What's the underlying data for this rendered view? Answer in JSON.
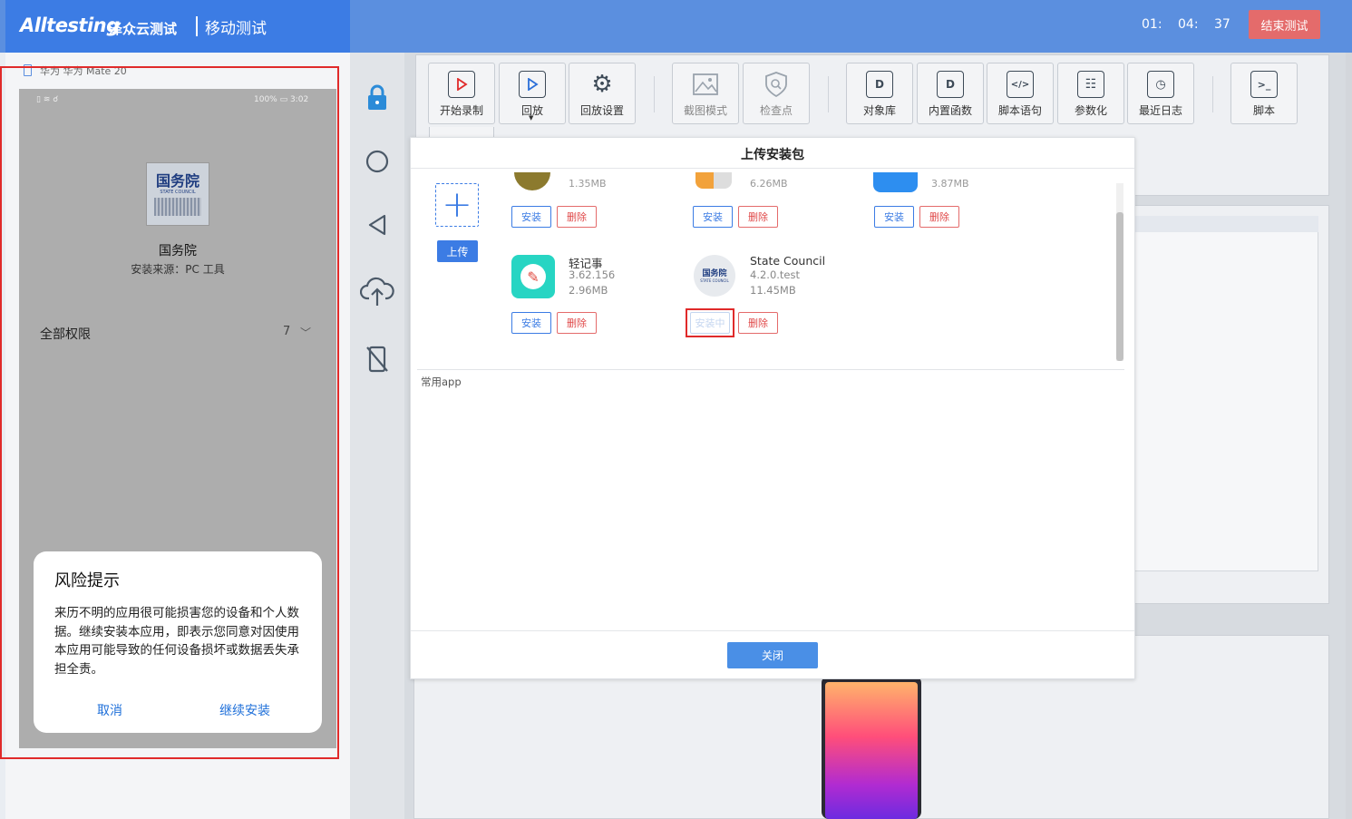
{
  "header": {
    "logo_text": "Alltesting",
    "logo_cn": "泽众云测试",
    "module_title": "移动测试",
    "timer": {
      "hours": "01:",
      "minutes": "04:",
      "seconds": "37"
    },
    "end_button": "结束测试",
    "brand_color": "#3c7ce4",
    "end_button_color": "#e46b6b"
  },
  "device": {
    "name": "华为 华为 Mate 20",
    "status_left": "▯ ≋ ☌",
    "status_right": "100% ▭ 3:02",
    "app_icon_cn": "国务院",
    "app_icon_en": "STATE COUNCIL",
    "app_name": "国务院",
    "install_source": "安装来源：PC 工具",
    "permissions_label": "全部权限",
    "permissions_count": "7",
    "risk_dialog": {
      "title": "风险提示",
      "text": "来历不明的应用很可能损害您的设备和个人数据。继续安装本应用，即表示您同意对因使用本应用可能导致的任何设备损坏或数据丢失承担全责。",
      "cancel": "取消",
      "continue": "继续安装"
    }
  },
  "sidebar": {
    "icons": [
      "lock-icon",
      "home-circle-icon",
      "back-triangle-icon",
      "cloud-upload-icon",
      "no-phone-icon"
    ]
  },
  "toolbar": {
    "start_record": "开始录制",
    "playback": "回放",
    "playback_settings": "回放设置",
    "screenshot_mode": "截图模式",
    "checkpoint": "检查点",
    "object_library": "对象库",
    "builtin_functions": "内置函数",
    "script_statement": "脚本语句",
    "parameterize": "参数化",
    "recent_logs": "最近日志",
    "script": "脚本"
  },
  "modal": {
    "title": "上传安装包",
    "upload_button": "上传",
    "install_label": "安装",
    "installing_label": "安装中",
    "delete_label": "删除",
    "partial_apps": [
      {
        "size": "1.35MB"
      },
      {
        "size": "6.26MB"
      },
      {
        "size": "3.87MB"
      }
    ],
    "apps": [
      {
        "name": "轻记事",
        "version": "3.62.156",
        "size": "2.96MB"
      },
      {
        "name": "State Council",
        "version": "4.2.0.test",
        "size": "11.45MB",
        "icon_cn": "国务院",
        "icon_en": "STATE COUNCIL"
      }
    ],
    "common_apps_label": "常用app",
    "close_button": "关闭"
  }
}
